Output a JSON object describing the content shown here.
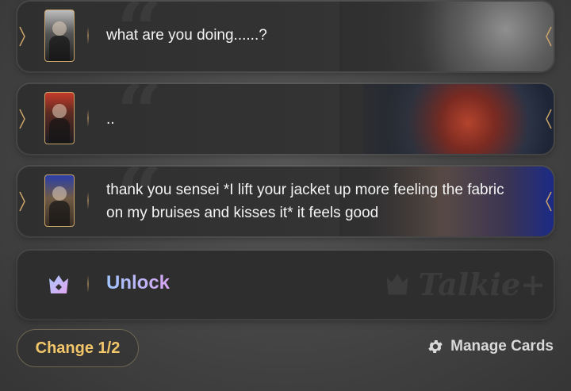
{
  "cards": [
    {
      "message": "what are you doing......?"
    },
    {
      "message": ".."
    },
    {
      "message": "thank you sensei *I lift your jacket up more feeling the fabric on my bruises and kisses it* it feels good"
    }
  ],
  "unlock": {
    "label": "Unlock",
    "brand": "Talkie+"
  },
  "footer": {
    "change_label": "Change 1/2",
    "manage_label": "Manage Cards"
  },
  "icons": {
    "crown": "crown-icon",
    "gear": "gear-icon",
    "quote": "quote-icon",
    "chevron": "chevron-icon"
  },
  "colors": {
    "accent_gold": "#f3c66a",
    "frame_gold": "#caa56a",
    "unlock_gradient_start": "#9fc6ff",
    "unlock_gradient_end": "#d9a6f2"
  }
}
